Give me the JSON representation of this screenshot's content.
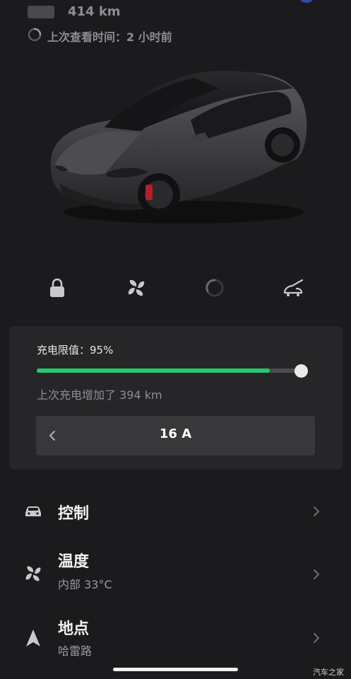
{
  "status": {
    "range": "414 km",
    "last_checked": "上次查看时间：2 小时前"
  },
  "quick_actions": {
    "icons": [
      "lock-icon",
      "fan-icon",
      "loading-spinner-icon",
      "frunk-icon"
    ]
  },
  "charging": {
    "limit_label": "充电限值：95%",
    "limit_fraction": 0.95,
    "slider_fill_fraction": 0.88,
    "added_text": "上次充电增加了 394 km",
    "current_amps": "16 A"
  },
  "menu": {
    "controls": {
      "title": "控制",
      "icon": "car-icon"
    },
    "climate": {
      "title": "温度",
      "subtitle": "内部 33°C",
      "icon": "fan-icon"
    },
    "location": {
      "title": "地点",
      "subtitle": "哈雷路",
      "icon": "navigation-arrow-icon"
    }
  },
  "watermark": "汽车之家",
  "colors": {
    "background": "#1b1b1d",
    "card": "#262628",
    "accent_green": "#27c871",
    "text_secondary": "#8e8e93"
  }
}
